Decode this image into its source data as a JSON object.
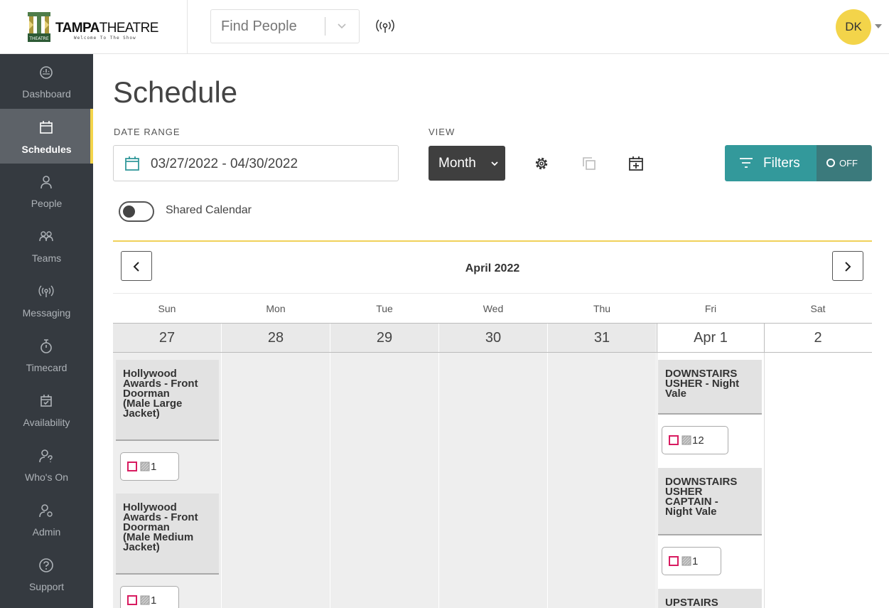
{
  "brand": {
    "name_bold": "TAMPA",
    "name_rest": "THEATRE",
    "tagline": "Welcome To The Show",
    "emblem_text": "THEATRE"
  },
  "topbar": {
    "search_placeholder": "Find People",
    "user_initials": "DK"
  },
  "sidebar": {
    "items": [
      {
        "label": "Dashboard",
        "icon": "gauge-icon"
      },
      {
        "label": "Schedules",
        "icon": "calendar-icon",
        "active": true
      },
      {
        "label": "People",
        "icon": "person-icon"
      },
      {
        "label": "Teams",
        "icon": "team-icon"
      },
      {
        "label": "Messaging",
        "icon": "broadcast-icon"
      },
      {
        "label": "Timecard",
        "icon": "stopwatch-icon"
      },
      {
        "label": "Availability",
        "icon": "calendar-check-icon"
      },
      {
        "label": "Who's On",
        "icon": "person-question-icon"
      },
      {
        "label": "Admin",
        "icon": "person-gear-icon"
      },
      {
        "label": "Support",
        "icon": "help-icon"
      }
    ]
  },
  "page": {
    "title": "Schedule",
    "date_range_label": "DATE RANGE",
    "date_range_value": "03/27/2022 - 04/30/2022",
    "view_label": "VIEW",
    "view_value": "Month",
    "filters_label": "Filters",
    "filters_state": "OFF",
    "shared_calendar_label": "Shared Calendar",
    "shared_calendar_on": false
  },
  "calendar": {
    "month_title": "April 2022",
    "weekdays": [
      "Sun",
      "Mon",
      "Tue",
      "Wed",
      "Thu",
      "Fri",
      "Sat"
    ],
    "dates": [
      {
        "label": "27",
        "in_month": false
      },
      {
        "label": "28",
        "in_month": false
      },
      {
        "label": "29",
        "in_month": false
      },
      {
        "label": "30",
        "in_month": false
      },
      {
        "label": "31",
        "in_month": false
      },
      {
        "label": "Apr 1",
        "in_month": true
      },
      {
        "label": "2",
        "in_month": true
      }
    ],
    "shifts": {
      "sun": [
        {
          "title_lines": [
            "Hollywood",
            "Awards - Front",
            "Doorman",
            "(Male Large",
            "Jacket)"
          ],
          "count": "1"
        },
        {
          "title_lines": [
            "Hollywood",
            "Awards - Front",
            "Doorman",
            "(Male Medium",
            "Jacket)"
          ],
          "count": "1"
        }
      ],
      "fri": [
        {
          "title_lines": [
            "DOWNSTAIRS",
            "USHER - Night",
            "Vale"
          ],
          "count": "12"
        },
        {
          "title_lines": [
            "DOWNSTAIRS",
            "USHER",
            "CAPTAIN -",
            "Night Vale"
          ],
          "count": "1"
        },
        {
          "title_lines": [
            "UPSTAIRS"
          ],
          "count": ""
        }
      ]
    }
  },
  "colors": {
    "sidebar_bg": "#353a40",
    "sidebar_active": "#5d6268",
    "accent_yellow": "#f3d44a",
    "filters_teal": "#33999b",
    "unfilled_red": "#d81b60"
  }
}
